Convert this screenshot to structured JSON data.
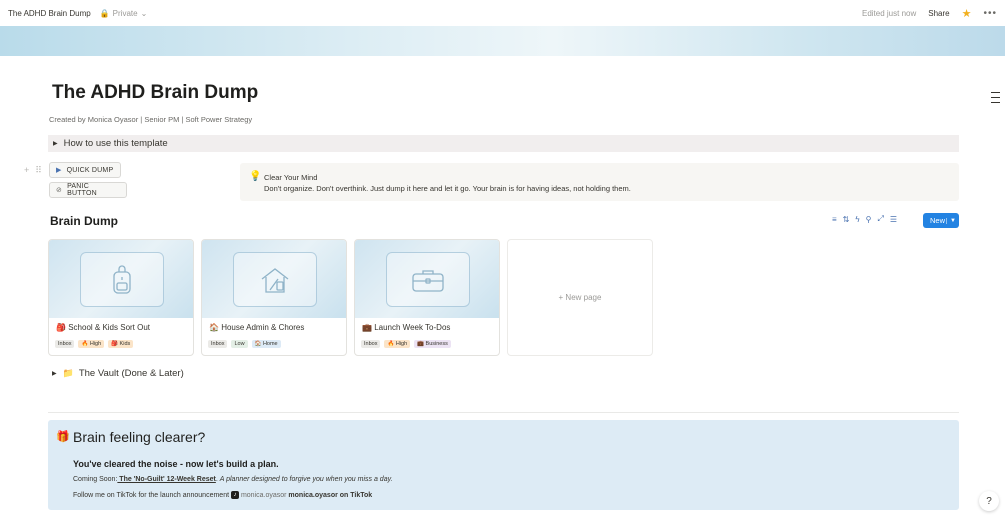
{
  "topbar": {
    "page_name": "The ADHD Brain Dump",
    "privacy_label": "Private",
    "edited_text": "Edited just now",
    "share_label": "Share"
  },
  "page": {
    "title": "The ADHD Brain Dump",
    "byline": "Created by Monica Oyasor | Senior PM | Soft Power Strategy"
  },
  "how_to_toggle": {
    "label": "How to use this template"
  },
  "buttons": {
    "quick_dump": "QUICK DUMP",
    "panic": "PANIC BUTTON"
  },
  "callout": {
    "title": "Clear Your Mind",
    "body": "Don't organize. Don't overthink. Just dump it here and let it go. Your brain is for having ideas, not holding them."
  },
  "database": {
    "title": "Brain Dump",
    "new_label": "New",
    "new_page_label": "+ New page",
    "cards": [
      {
        "emoji": "🎒",
        "name": "School & Kids Sort Out",
        "icon": "backpack-icon",
        "tags": [
          {
            "text": "Inbox",
            "color": "gray"
          },
          {
            "text": "🔥 High",
            "color": "orange"
          },
          {
            "text": "🎒 Kids",
            "color": "orange"
          }
        ]
      },
      {
        "emoji": "🏠",
        "name": "House Admin & Chores",
        "icon": "house-tools-icon",
        "tags": [
          {
            "text": "Inbox",
            "color": "gray"
          },
          {
            "text": "Low",
            "color": "green"
          },
          {
            "text": "🏠 Home",
            "color": "blue"
          }
        ]
      },
      {
        "emoji": "💼",
        "name": "Launch Week To-Dos",
        "icon": "briefcase-icon",
        "tags": [
          {
            "text": "Inbox",
            "color": "gray"
          },
          {
            "text": "🔥 High",
            "color": "orange"
          },
          {
            "text": "💼 Business",
            "color": "purple"
          }
        ]
      }
    ]
  },
  "vault": {
    "label": "The Vault (Done & Later)"
  },
  "promo": {
    "title": "Brain feeling clearer?",
    "subtitle": "You've cleared the noise - now let's build a plan.",
    "coming_soon_label": "Coming Soon:",
    "coming_soon_link": " The 'No-Guilt' 12-Week Reset",
    "coming_soon_desc": "A planner designed to forgive you when you miss a day.",
    "follow_text": "Follow me on TikTok for the launch announcement",
    "handle": "monica.oyasor",
    "handle_link": "monica.oyasor on TikTok"
  },
  "colors": {
    "accent": "#2383e2",
    "promo_bg": "#ddebf5",
    "callout_bg": "#f7f6f3"
  }
}
